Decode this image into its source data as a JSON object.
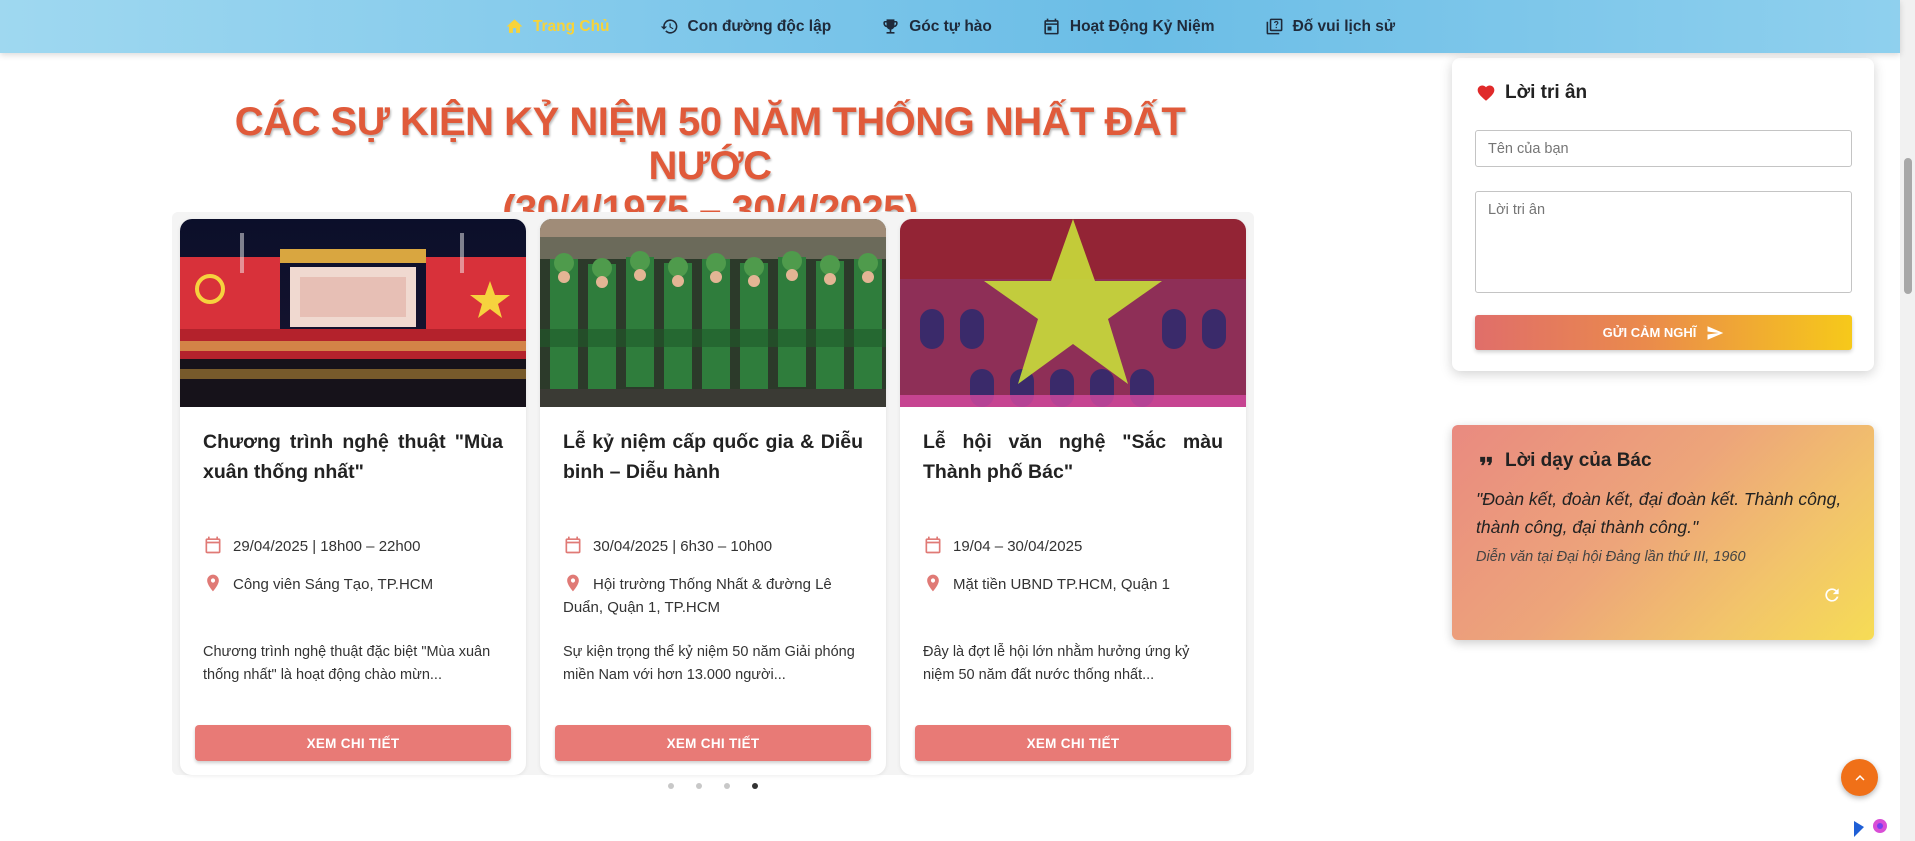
{
  "nav": {
    "items": [
      {
        "label": "Trang Chủ",
        "icon": "home-icon",
        "active": true
      },
      {
        "label": "Con đường độc lập",
        "icon": "history-icon",
        "active": false
      },
      {
        "label": "Góc tự hào",
        "icon": "trophy-icon",
        "active": false
      },
      {
        "label": "Hoạt Động Kỷ Niệm",
        "icon": "calendar-icon",
        "active": false
      },
      {
        "label": "Đố vui lịch sử",
        "icon": "quiz-icon",
        "active": false
      }
    ]
  },
  "page": {
    "title_line1": "CÁC SỰ KIỆN KỶ NIỆM 50 NĂM THỐNG NHẤT ĐẤT NƯỚC",
    "title_line2": "(30/4/1975 – 30/4/2025)"
  },
  "events": [
    {
      "title": "Chương trình nghệ thuật \"Mùa xuân thống nhất\"",
      "date": "29/04/2025 | 18h00 – 22h00",
      "location": "Công viên Sáng Tạo, TP.HCM",
      "description": "Chương trình nghệ thuật đặc biệt \"Mùa xuân thống nhất\" là hoạt động chào mừn...",
      "button": "XEM CHI TIẾT"
    },
    {
      "title": "Lễ kỷ niệm cấp quốc gia & Diễu binh – Diễu hành",
      "date": "30/04/2025 | 6h30 – 10h00",
      "location": "Hội trường Thống Nhất & đường Lê Duẩn, Quận 1, TP.HCM",
      "description": "Sự kiện trọng thể kỷ niệm 50 năm Giải phóng miền Nam với hơn 13.000 người...",
      "button": "XEM CHI TIẾT"
    },
    {
      "title": "Lễ hội văn nghệ \"Sắc màu Thành phố Bác\"",
      "date": "19/04 – 30/04/2025",
      "location": "Mặt tiền UBND TP.HCM, Quận 1",
      "description": "Đây là đợt lễ hội lớn nhằm hưởng ứng kỷ niệm 50 năm đất nước thống nhất...",
      "button": "XEM CHI TIẾT"
    }
  ],
  "carousel": {
    "dot_count": 4,
    "active_index": 3
  },
  "gratitude": {
    "title": "Lời tri ân",
    "name_placeholder": "Tên của bạn",
    "message_placeholder": "Lời tri ân",
    "submit_label": "GỬI CẢM NGHĨ"
  },
  "quote": {
    "title": "Lời dạy của Bác",
    "text": "\"Đoàn kết, đoàn kết, đại đoàn kết. Thành công, thành công, đại thành công.\"",
    "source": "Diễn văn tại Đại hội Đảng lần thứ III, 1960"
  },
  "colors": {
    "nav_active": "#f7d33a",
    "heading": "#e05a3a",
    "button": "#e87a76",
    "scroll_top": "#f07018"
  }
}
